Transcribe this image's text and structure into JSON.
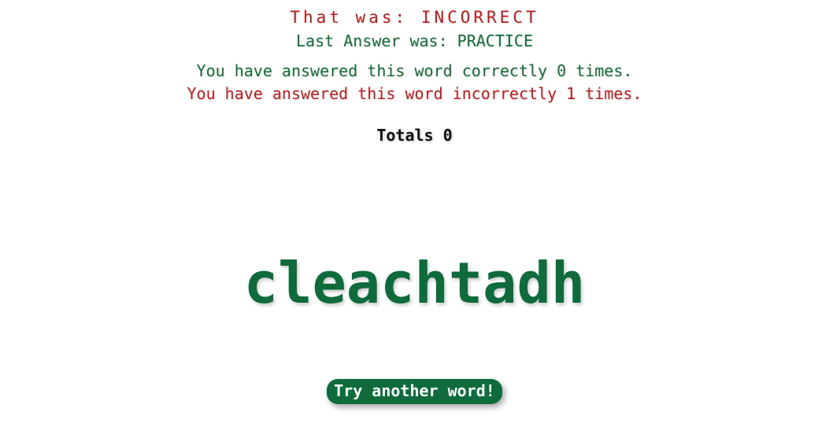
{
  "feedback": {
    "result_text": "That was: INCORRECT",
    "last_answer_text": "Last Answer was: PRACTICE",
    "correct_count_text": "You have answered this word correctly 0 times.",
    "incorrect_count_text": "You have answered this word incorrectly 1 times."
  },
  "totals": {
    "text": "Totals 0"
  },
  "quiz": {
    "word": "cleachtadh"
  },
  "actions": {
    "try_another_label": "Try another word!"
  },
  "colors": {
    "correct_green": "#176b3a",
    "incorrect_red": "#b22222",
    "word_green": "#0f6b3c",
    "button_green": "#0f6b3c"
  }
}
